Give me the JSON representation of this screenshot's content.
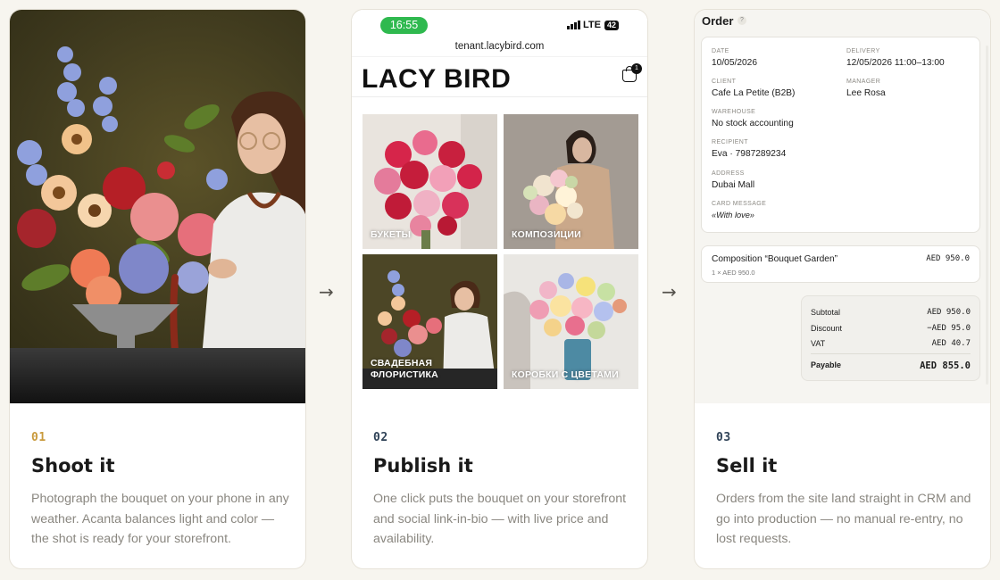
{
  "cards": [
    {
      "num": "01",
      "title": "Shoot it",
      "desc": "Photograph the bouquet on your phone in any weather. Acanta balances light and color — the shot is ready for your storefront.",
      "num_color": "#c99a3c"
    },
    {
      "num": "02",
      "title": "Publish it",
      "desc": "One click puts the bouquet on your storefront and social link-in-bio — with live price and availability.",
      "num_color": "#2f4257"
    },
    {
      "num": "03",
      "title": "Sell it",
      "desc": "Orders from the site land straight in CRM and go into production — no manual re-entry, no lost requests.",
      "num_color": "#2f4257"
    }
  ],
  "arrows": [
    "→",
    "→"
  ],
  "phone": {
    "time": "16:55",
    "network": "LTE",
    "battery": "42",
    "url": "tenant.lacybird.com",
    "brand": "LACY BIRD",
    "cart_count": "1",
    "tiles": [
      "БУКЕТЫ",
      "КОМПОЗИЦИИ",
      "СВАДЕБНАЯ ФЛОРИСТИКА",
      "КОРОБКИ С ЦВЕТАМИ"
    ]
  },
  "order": {
    "title": "Order",
    "info_icon": "?",
    "fields": {
      "date": {
        "label": "DATE",
        "value": "10/05/2026"
      },
      "delivery": {
        "label": "DELIVERY",
        "value": "12/05/2026 11:00–13:00"
      },
      "client": {
        "label": "CLIENT",
        "value": "Cafe La Petite (B2B)"
      },
      "manager": {
        "label": "MANAGER",
        "value": "Lee Rosa"
      },
      "warehouse": {
        "label": "WAREHOUSE",
        "value": "No stock accounting"
      },
      "recipient": {
        "label": "RECIPIENT",
        "value": "Eva · 7987289234"
      },
      "address": {
        "label": "ADDRESS",
        "value": "Dubai Mall"
      },
      "card_message": {
        "label": "CARD MESSAGE",
        "value": "«With love»"
      }
    },
    "item": {
      "name": "Composition “Bouquet Garden”",
      "price": "AED 950.0",
      "qty": "1 × AED 950.0"
    },
    "totals": {
      "subtotal_label": "Subtotal",
      "subtotal": "AED 950.0",
      "discount_label": "Discount",
      "discount": "−AED 95.0",
      "vat_label": "VAT",
      "vat": "AED 40.7",
      "payable_label": "Payable",
      "payable": "AED 855.0"
    }
  }
}
